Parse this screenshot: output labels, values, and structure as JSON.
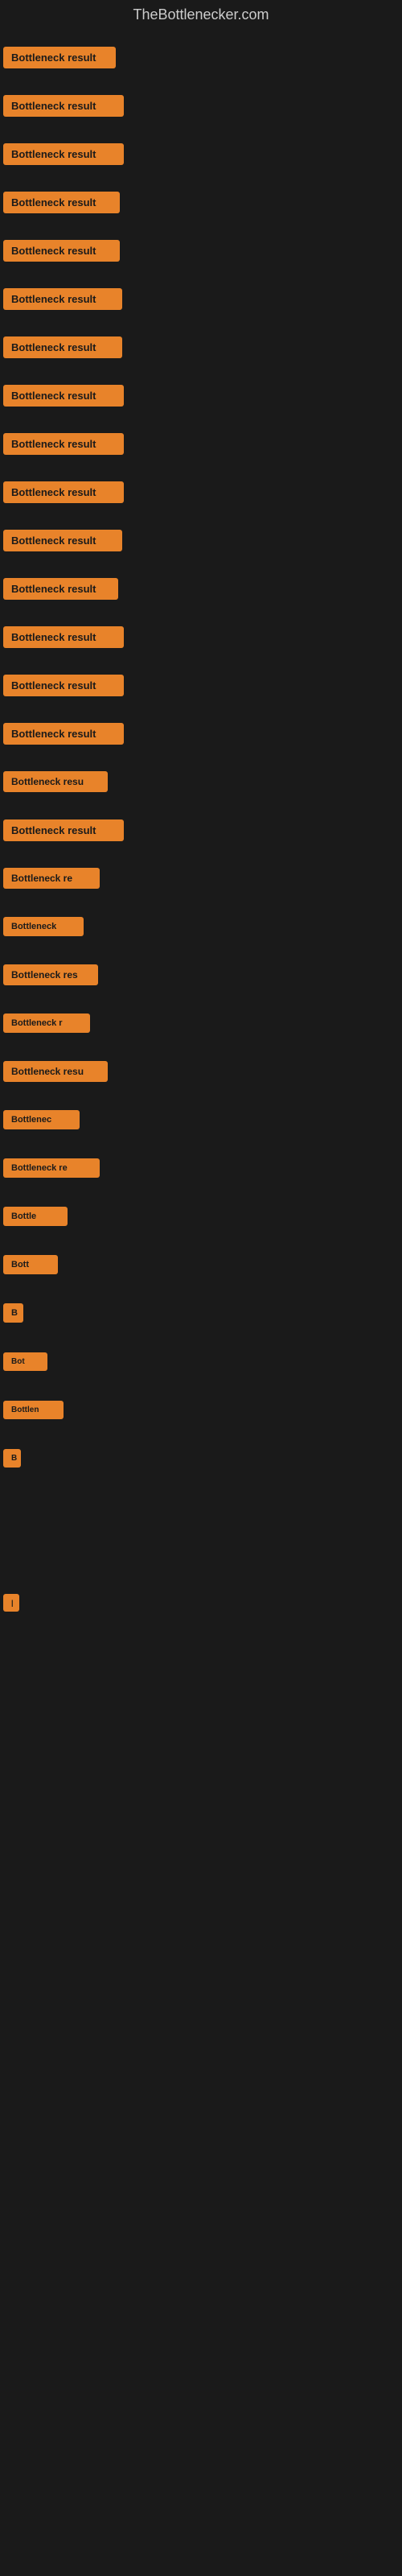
{
  "site": {
    "title": "TheBottlenecker.com"
  },
  "rows": [
    {
      "id": 1,
      "label": "Bottleneck result"
    },
    {
      "id": 2,
      "label": "Bottleneck result"
    },
    {
      "id": 3,
      "label": "Bottleneck result"
    },
    {
      "id": 4,
      "label": "Bottleneck result"
    },
    {
      "id": 5,
      "label": "Bottleneck result"
    },
    {
      "id": 6,
      "label": "Bottleneck result"
    },
    {
      "id": 7,
      "label": "Bottleneck result"
    },
    {
      "id": 8,
      "label": "Bottleneck result"
    },
    {
      "id": 9,
      "label": "Bottleneck result"
    },
    {
      "id": 10,
      "label": "Bottleneck result"
    },
    {
      "id": 11,
      "label": "Bottleneck result"
    },
    {
      "id": 12,
      "label": "Bottleneck result"
    },
    {
      "id": 13,
      "label": "Bottleneck result"
    },
    {
      "id": 14,
      "label": "Bottleneck result"
    },
    {
      "id": 15,
      "label": "Bottleneck result"
    },
    {
      "id": 16,
      "label": "Bottleneck resu"
    },
    {
      "id": 17,
      "label": "Bottleneck result"
    },
    {
      "id": 18,
      "label": "Bottleneck re"
    },
    {
      "id": 19,
      "label": "Bottleneck"
    },
    {
      "id": 20,
      "label": "Bottleneck res"
    },
    {
      "id": 21,
      "label": "Bottleneck r"
    },
    {
      "id": 22,
      "label": "Bottleneck resu"
    },
    {
      "id": 23,
      "label": "Bottlenec"
    },
    {
      "id": 24,
      "label": "Bottleneck re"
    },
    {
      "id": 25,
      "label": "Bottle"
    },
    {
      "id": 26,
      "label": "Bott"
    },
    {
      "id": 27,
      "label": "B"
    },
    {
      "id": 28,
      "label": "Bot"
    },
    {
      "id": 29,
      "label": "Bottlen"
    },
    {
      "id": 30,
      "label": "B"
    },
    {
      "id": 31,
      "label": ""
    },
    {
      "id": 32,
      "label": ""
    },
    {
      "id": 33,
      "label": "|"
    },
    {
      "id": 34,
      "label": ""
    },
    {
      "id": 35,
      "label": ""
    },
    {
      "id": 36,
      "label": ""
    }
  ]
}
